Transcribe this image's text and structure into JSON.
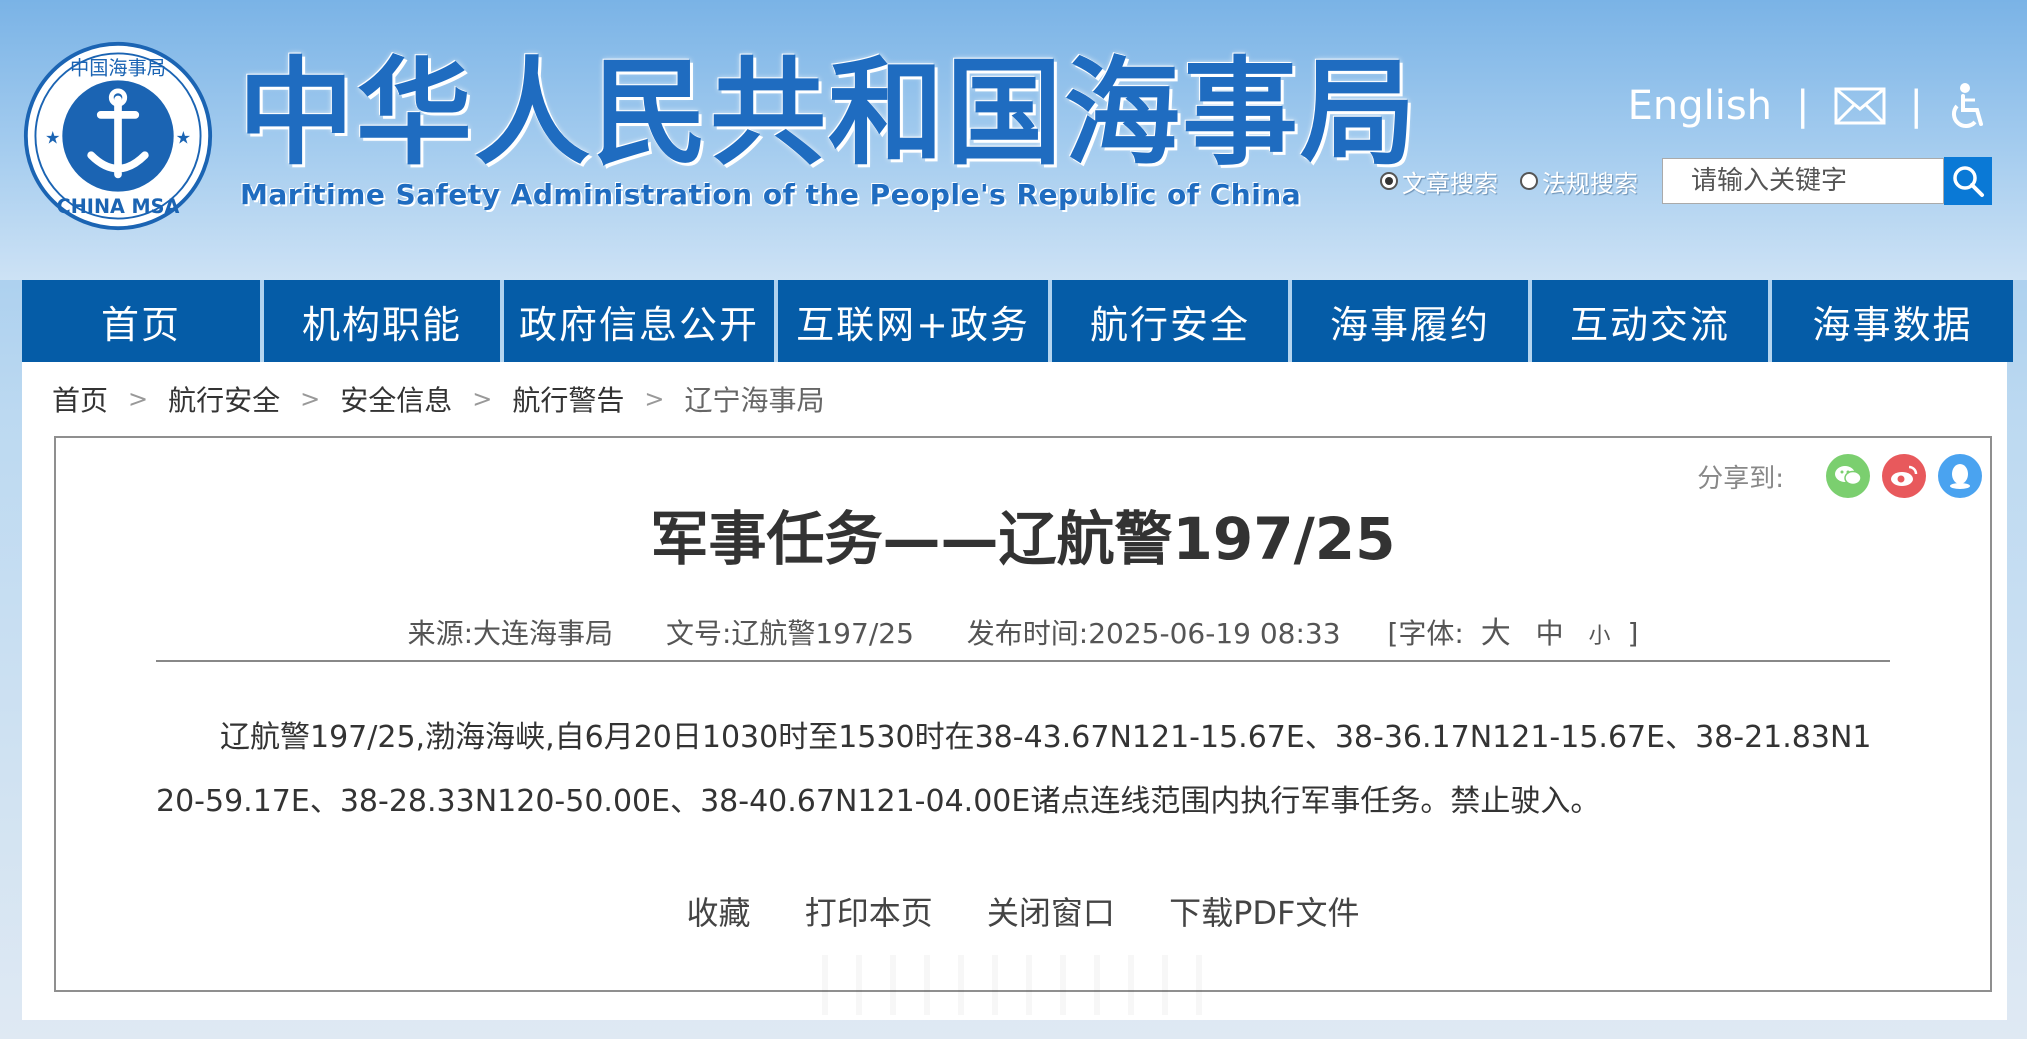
{
  "header": {
    "title_cn": "中华人民共和国海事局",
    "title_en": "Maritime Safety Administration of the People's Republic of China",
    "logo_text_cn": "中国海事局",
    "logo_text_en": "CHINA MSA",
    "english_link": "English",
    "search": {
      "option_article": "文章搜索",
      "option_law": "法规搜索",
      "placeholder": "请输入关键字",
      "selected": "文章搜索"
    }
  },
  "nav": {
    "items": [
      {
        "label": "首页"
      },
      {
        "label": "机构职能"
      },
      {
        "label": "政府信息公开"
      },
      {
        "label": "互联网+政务"
      },
      {
        "label": "航行安全"
      },
      {
        "label": "海事履约"
      },
      {
        "label": "互动交流"
      },
      {
        "label": "海事数据"
      }
    ]
  },
  "breadcrumb": {
    "items": [
      "首页",
      "航行安全",
      "安全信息",
      "航行警告",
      "辽宁海事局"
    ],
    "separator": ">"
  },
  "article": {
    "share_label": "分享到:",
    "title": "军事任务——辽航警197/25",
    "source": "来源:大连海事局",
    "doc_no": "文号:辽航警197/25",
    "publish_time": "发布时间:2025-06-19 08:33",
    "font_size_label": "[字体:",
    "font_large": "大",
    "font_medium": "中",
    "font_small": "小",
    "font_size_close": "]",
    "body": "辽航警197/25,渤海海峡,自6月20日1030时至1530时在38-43.67N121-15.67E、38-36.17N121-15.67E、38-21.83N120-59.17E、38-28.33N120-50.00E、38-40.67N121-04.00E诸点连线范围内执行军事任务。禁止驶入。",
    "actions": [
      "收藏",
      "打印本页",
      "关闭窗口",
      "下载PDF文件"
    ]
  },
  "colors": {
    "nav_bg": "#055ca7",
    "title_blue": "#1f6cc0",
    "search_btn": "#0a79d6",
    "share_wechat": "#7bcf6f",
    "share_weibo": "#e8595c",
    "share_qq": "#4aa3f0"
  }
}
